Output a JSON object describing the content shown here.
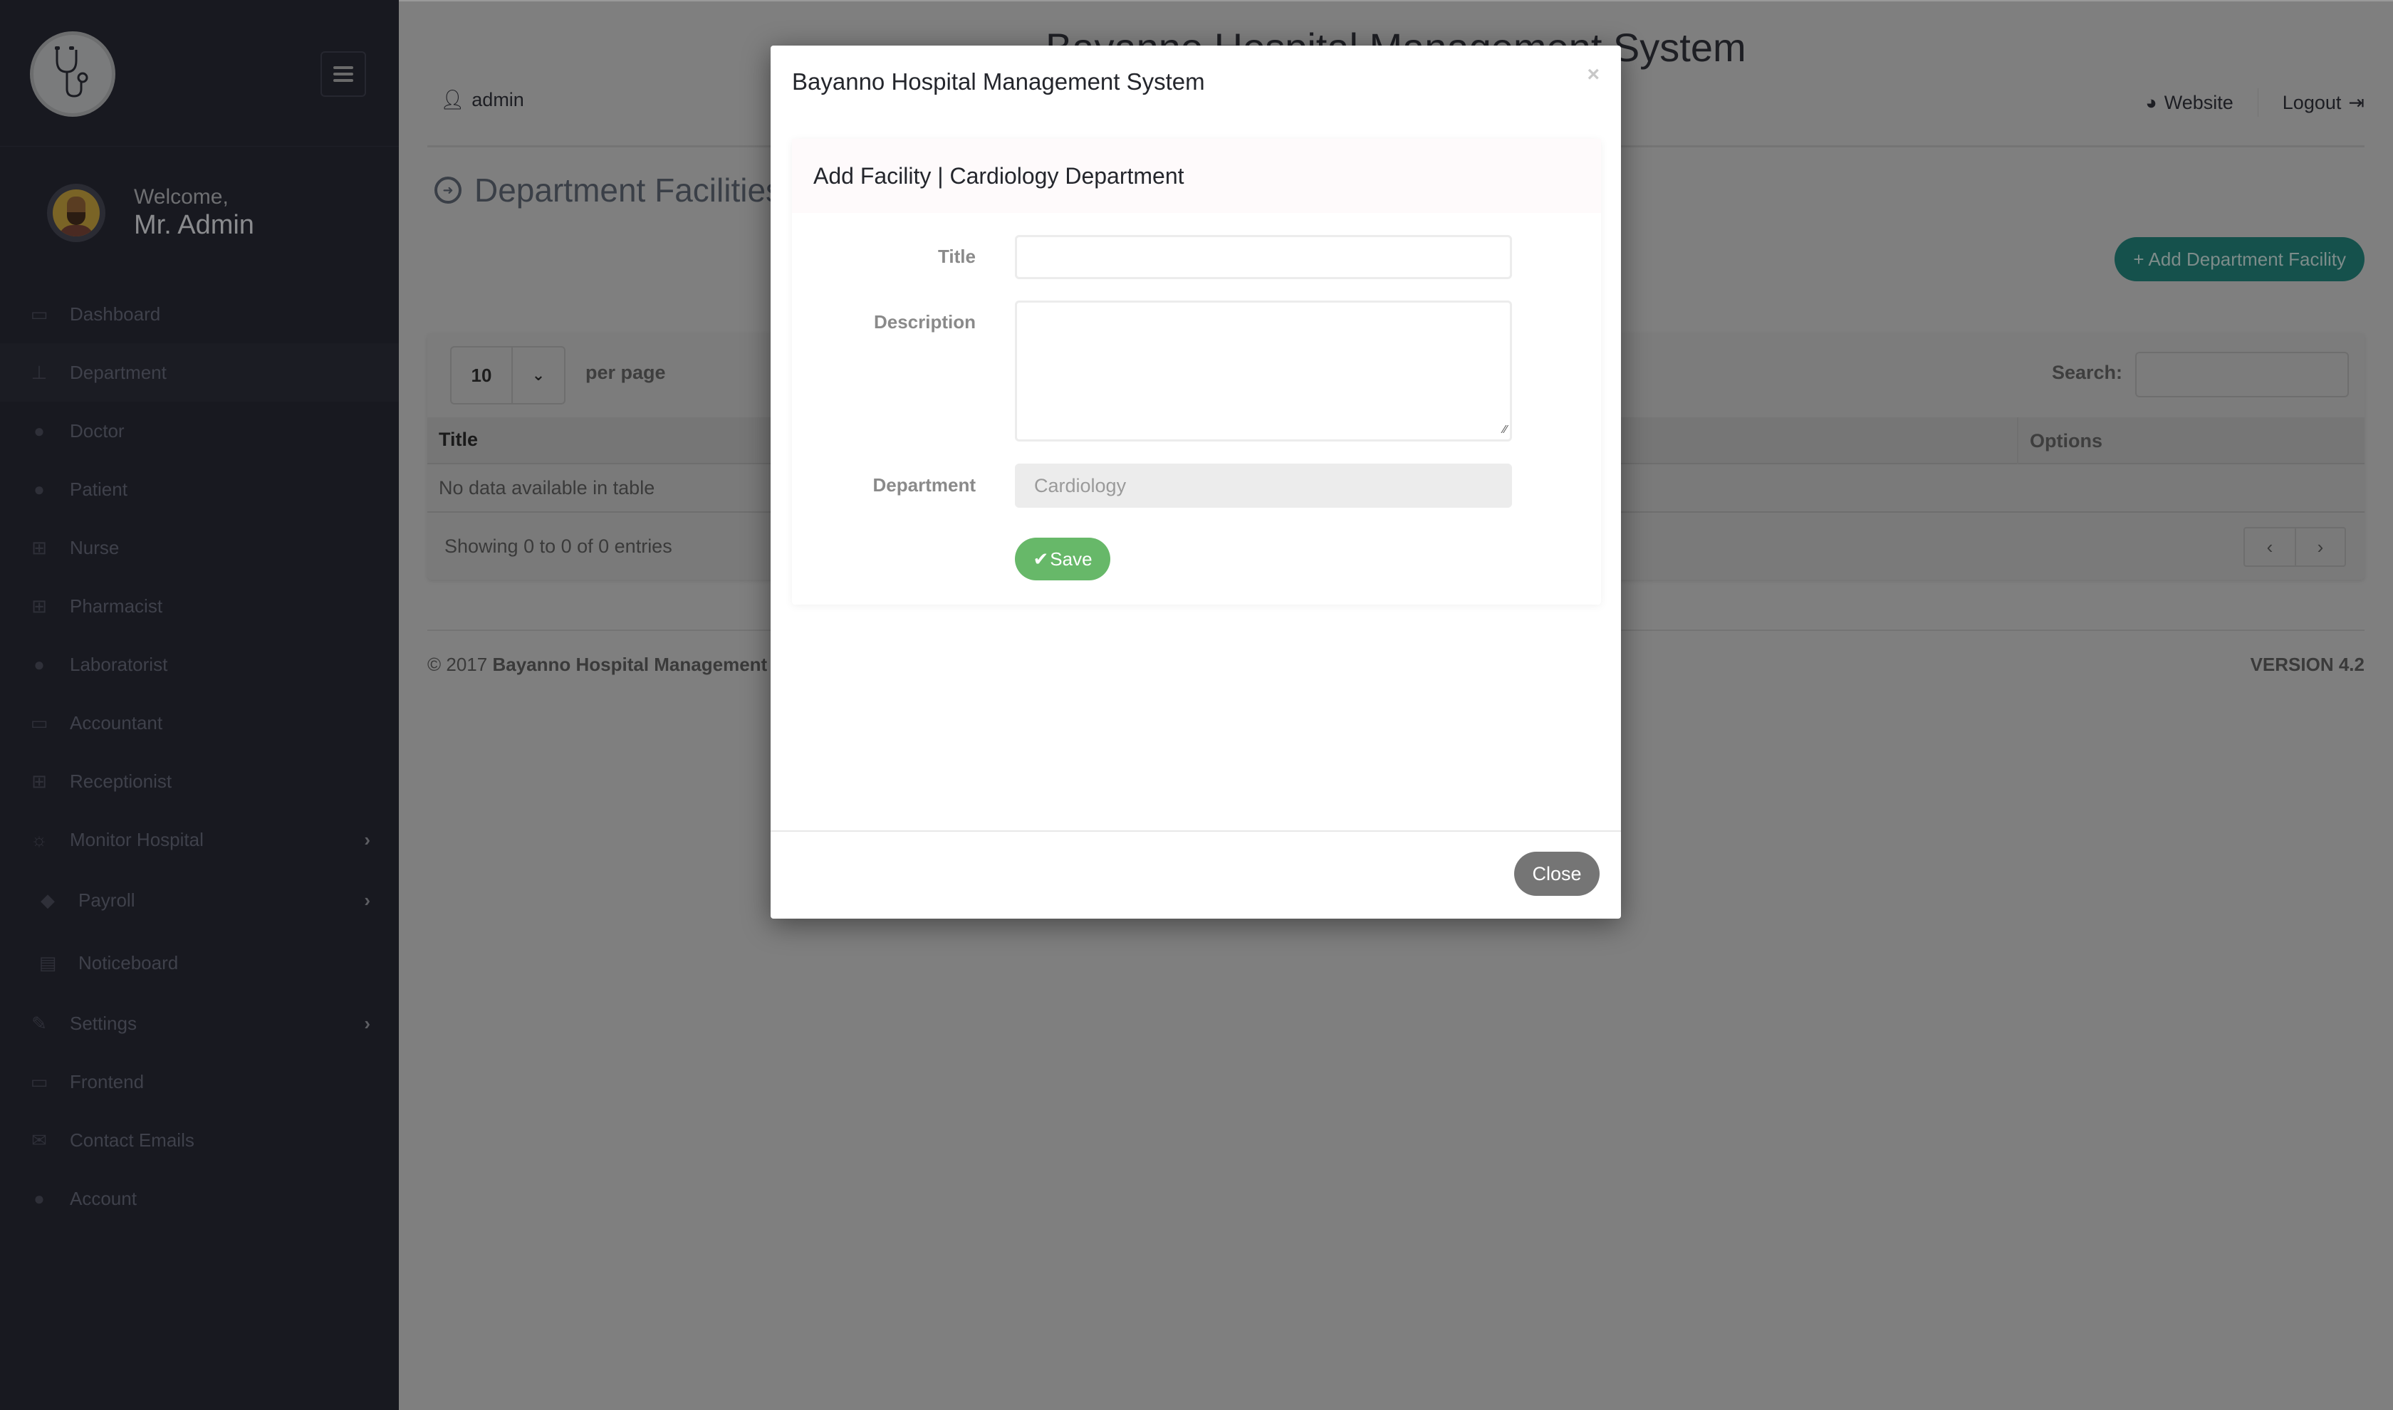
{
  "sidebar": {
    "logo_icon": "stethoscope-icon",
    "welcome_line": "Welcome,",
    "user_name": "Mr. Admin",
    "items": [
      {
        "label": "Dashboard",
        "icon": "desktop-icon"
      },
      {
        "label": "Department",
        "icon": "sitemap-icon",
        "active": true
      },
      {
        "label": "Doctor",
        "icon": "user-md-icon"
      },
      {
        "label": "Patient",
        "icon": "user-icon"
      },
      {
        "label": "Nurse",
        "icon": "plus-square-icon"
      },
      {
        "label": "Pharmacist",
        "icon": "medkit-icon"
      },
      {
        "label": "Laboratorist",
        "icon": "user-icon"
      },
      {
        "label": "Accountant",
        "icon": "money-icon"
      },
      {
        "label": "Receptionist",
        "icon": "plus-square-icon"
      },
      {
        "label": "Monitor Hospital",
        "icon": "sun-icon",
        "has_submenu": true
      },
      {
        "label": "Payroll",
        "icon": "tag-icon",
        "has_submenu": true
      },
      {
        "label": "Noticeboard",
        "icon": "list-alt-icon"
      },
      {
        "label": "Settings",
        "icon": "wrench-icon",
        "has_submenu": true
      },
      {
        "label": "Frontend",
        "icon": "laptop-icon"
      },
      {
        "label": "Contact Emails",
        "icon": "envelope-icon"
      },
      {
        "label": "Account",
        "icon": "user-icon"
      }
    ]
  },
  "header": {
    "app_title": "Bayanno Hospital Management System",
    "user": "admin",
    "website_label": "Website",
    "logout_label": "Logout"
  },
  "page": {
    "title": "Department Facilities",
    "add_button": "Add Department Facility",
    "table": {
      "length_value": "10",
      "per_page_label": "per page",
      "search_label": "Search:",
      "search_value": "",
      "columns": [
        "Title",
        "Options"
      ],
      "empty_message": "No data available in table",
      "info": "Showing 0 to 0 of 0 entries",
      "prev_label": "‹",
      "next_label": "›"
    },
    "footer": {
      "copyright_prefix": "© 2017 ",
      "copyright_name": "Bayanno Hospital Management System",
      "version": "VERSION 4.2"
    }
  },
  "modal": {
    "title": "Bayanno Hospital Management System",
    "close_x": "×",
    "panel_title": "Add Facility | Cardiology Department",
    "fields": {
      "title_label": "Title",
      "title_value": "",
      "description_label": "Description",
      "description_value": "",
      "department_label": "Department",
      "department_value": "Cardiology"
    },
    "save_label": "Save",
    "close_label": "Close"
  },
  "colors": {
    "sidebar_bg": "#181920",
    "accent_teal": "#15514c",
    "save_green": "#67b869",
    "close_gray": "#757575"
  }
}
